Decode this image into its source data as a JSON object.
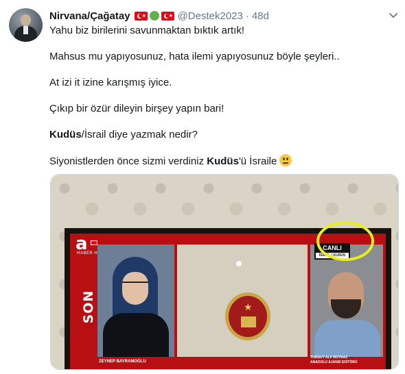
{
  "tweet": {
    "author_name": "Nirvana/Çağatay",
    "handle": "@Destek2023",
    "separator": "·",
    "time": "48d",
    "paragraphs": [
      "Yahu biz birilerini savunmaktan bıktık artık!",
      "Mahsus mu yapıyosunuz, hata ilemi yapıyosunuz böyle şeyleri..",
      "At izi it izine karışmış iyice.",
      "Çıkıp bir özür dileyin birşey yapın bari!"
    ],
    "p5_bold": "Kudüs",
    "p5_rest": "/İsrail diye yazmak nedir?",
    "p6_start": "Siyonistlerden önce sizmi verdiniz ",
    "p6_bold": "Kudüs",
    "p6_end": "'ü İsraile",
    "emoji_icon": "face-with-rolling-eyes",
    "flag_icons": [
      "turkey-flag",
      "green-circle",
      "turkey-flag"
    ]
  },
  "media": {
    "logo_letter": "a",
    "logo_sub": "HABER HD",
    "side_banner": "SON DURUM",
    "live_label": "CANLI",
    "live_sub": "İSRAİL / KUDÜS",
    "guest_left_name": "ZEYNEP BAYRAMOĞLU",
    "guest_right_name": "TURGUT ALP BOYRAZ",
    "guest_right_title": "ANADOLU AJANSI EDİTÖRÜ",
    "highlight_color": "#e7ef1f",
    "screen_color": "#b70f12"
  }
}
